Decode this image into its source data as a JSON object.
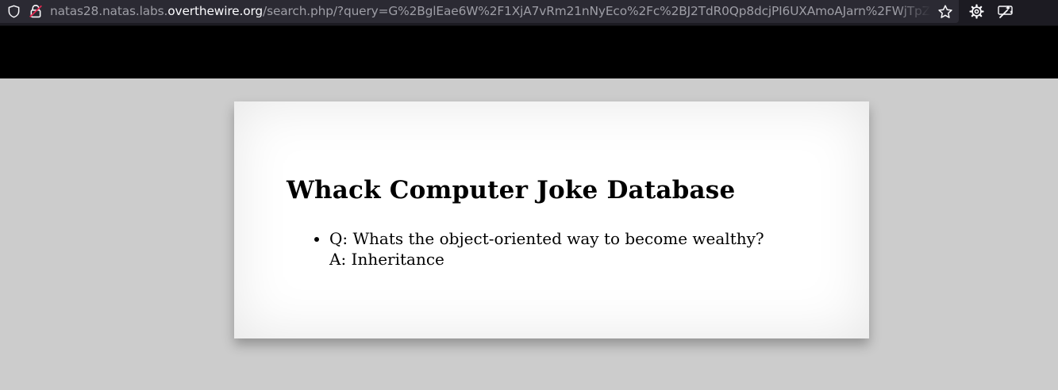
{
  "browser": {
    "url_domain_prefix": "natas28.natas.labs.",
    "url_domain_main": "overthewire.org",
    "url_path": "/search.php/?query=G%2BglEae6W%2F1XjA7vRm21nNyEco%2Fc%2BJ2TdR0Qp8dcjPI6UXAmoAJarn%2FWjTpZ",
    "icons": [
      "shield-icon",
      "lock-icon",
      "star-icon",
      "gear-icon",
      "wand-icon"
    ]
  },
  "page": {
    "title": "Whack Computer Joke Database",
    "jokes": [
      {
        "question": "Q: Whats the object-oriented way to become wealthy?",
        "answer": "A: Inheritance"
      }
    ]
  },
  "colors": {
    "toolbar": "#1c1b22",
    "urlbar": "#2b2a33",
    "top_band": "#000000",
    "page_background": "#cccccc",
    "card_background": "#ffffff"
  }
}
